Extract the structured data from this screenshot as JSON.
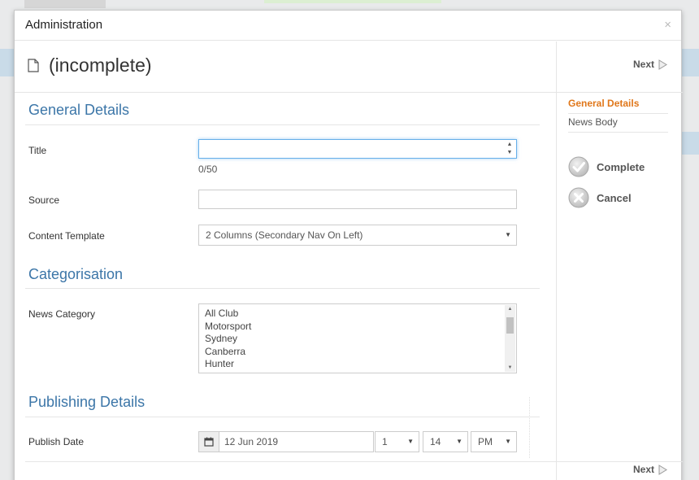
{
  "modal": {
    "title": "Administration",
    "close_glyph": "×"
  },
  "page": {
    "title": "(incomplete)",
    "icon": "document-icon"
  },
  "sections": {
    "general": "General Details",
    "categorisation": "Categorisation",
    "publishing": "Publishing Details"
  },
  "fields": {
    "title": {
      "label": "Title",
      "value": "",
      "counter": "0/50"
    },
    "source": {
      "label": "Source",
      "value": ""
    },
    "content_template": {
      "label": "Content Template",
      "selected": "2 Columns (Secondary Nav On Left)"
    },
    "news_category": {
      "label": "News Category",
      "options": [
        "All Club",
        "Motorsport",
        "Sydney",
        "Canberra",
        "Hunter"
      ]
    },
    "publish_date": {
      "label": "Publish Date",
      "date": "12 Jun 2019",
      "hour": "1",
      "minute": "14",
      "ampm": "PM"
    }
  },
  "sidebar": {
    "next_label": "Next",
    "steps": [
      "General Details",
      "News Body"
    ],
    "complete_label": "Complete",
    "cancel_label": "Cancel"
  },
  "colors": {
    "section_blue": "#3c76a8",
    "active_step": "#e0771a",
    "focus_border": "#66afe9"
  }
}
